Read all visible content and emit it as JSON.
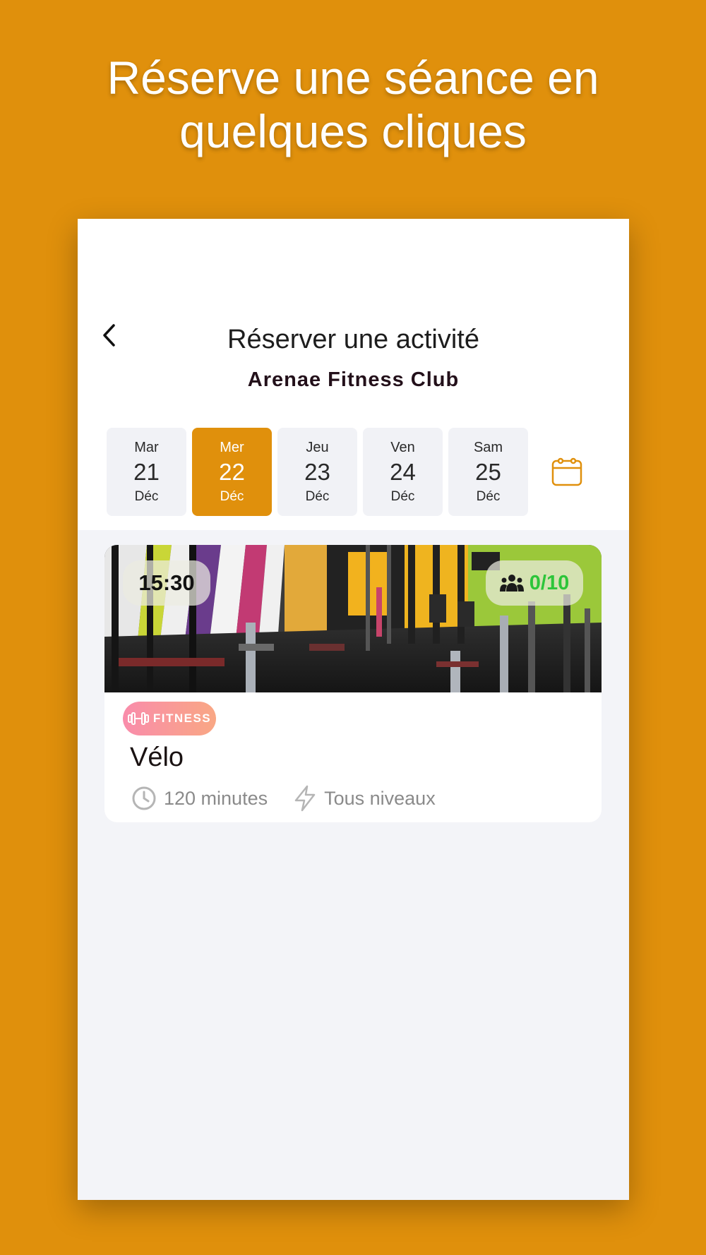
{
  "promo": {
    "headline_line1": "Réserve une séance en",
    "headline_line2": "quelques cliques"
  },
  "header": {
    "title": "Réserver une activité",
    "club_name": "Arenae Fitness Club"
  },
  "dates": [
    {
      "dow": "Mar",
      "day": "21",
      "month": "Déc",
      "selected": false
    },
    {
      "dow": "Mer",
      "day": "22",
      "month": "Déc",
      "selected": true
    },
    {
      "dow": "Jeu",
      "day": "23",
      "month": "Déc",
      "selected": false
    },
    {
      "dow": "Ven",
      "day": "24",
      "month": "Déc",
      "selected": false
    },
    {
      "dow": "Sam",
      "day": "25",
      "month": "Déc",
      "selected": false
    }
  ],
  "session": {
    "time": "15:30",
    "capacity": "0/10",
    "category": "FITNESS",
    "name": "Vélo",
    "duration": "120 minutes",
    "level": "Tous niveaux"
  },
  "colors": {
    "brand": "#E0900C",
    "capacity_ok": "#2DC53A",
    "badge_gradient_start": "#F98CAB",
    "badge_gradient_end": "#F9A784"
  },
  "icons": {
    "back": "chevron-left-icon",
    "calendar": "calendar-icon",
    "capacity": "people-group-icon",
    "category": "dumbbell-icon",
    "duration": "clock-icon",
    "level": "lightning-icon"
  }
}
